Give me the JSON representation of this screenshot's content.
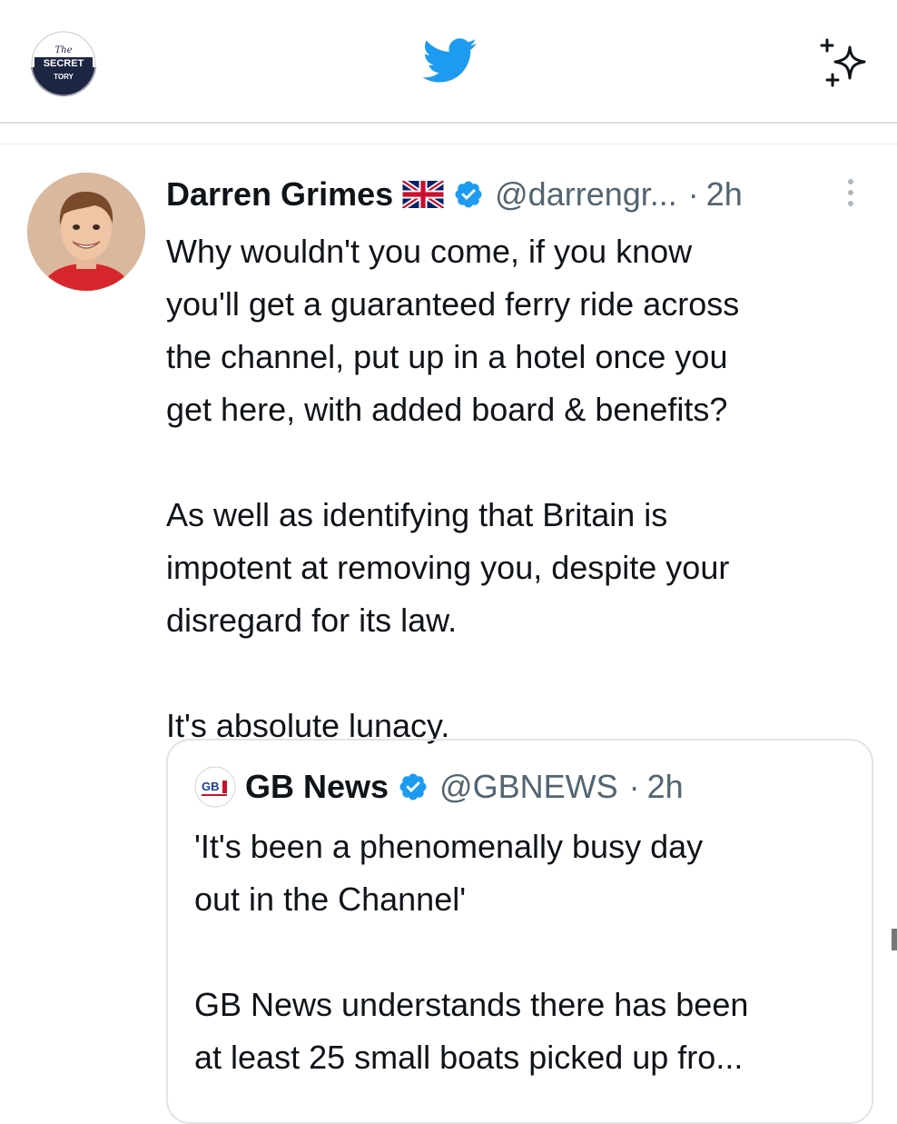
{
  "topbar": {
    "brand_logo_text": [
      "The",
      "SECRET",
      "TORY"
    ],
    "twitter_icon": "twitter-bird-icon",
    "timeline_icon": "sparkle-icon",
    "accent_color": "#1d9bf0"
  },
  "tweet": {
    "author_name": "Darren Grimes",
    "flag_icon": "uk-flag-icon",
    "verified_icon": "verified-badge-icon",
    "handle": "@darrengr...",
    "separator": "·",
    "time": "2h",
    "more_icon": "more-vertical-icon",
    "paragraphs": [
      [
        "Why wouldn't you come, if you know",
        "you'll get a guaranteed ferry ride across",
        "the channel, put up in a hotel once you",
        "get here, with added board & benefits?"
      ],
      [
        "As well as identifying that Britain is",
        "impotent at removing you, despite your",
        "disregard for its law."
      ],
      [
        "It's absolute lunacy."
      ]
    ]
  },
  "quoted_tweet": {
    "logo_icon": "gb-news-logo-icon",
    "author_name": "GB News",
    "verified_icon": "verified-badge-icon",
    "handle": "@GBNEWS",
    "separator": "·",
    "time": "2h",
    "paragraphs": [
      [
        "'It's been a phenomenally busy day",
        "out in the Channel'"
      ],
      [
        "GB News understands there has been",
        "at least 25 small boats picked up fro..."
      ]
    ]
  }
}
